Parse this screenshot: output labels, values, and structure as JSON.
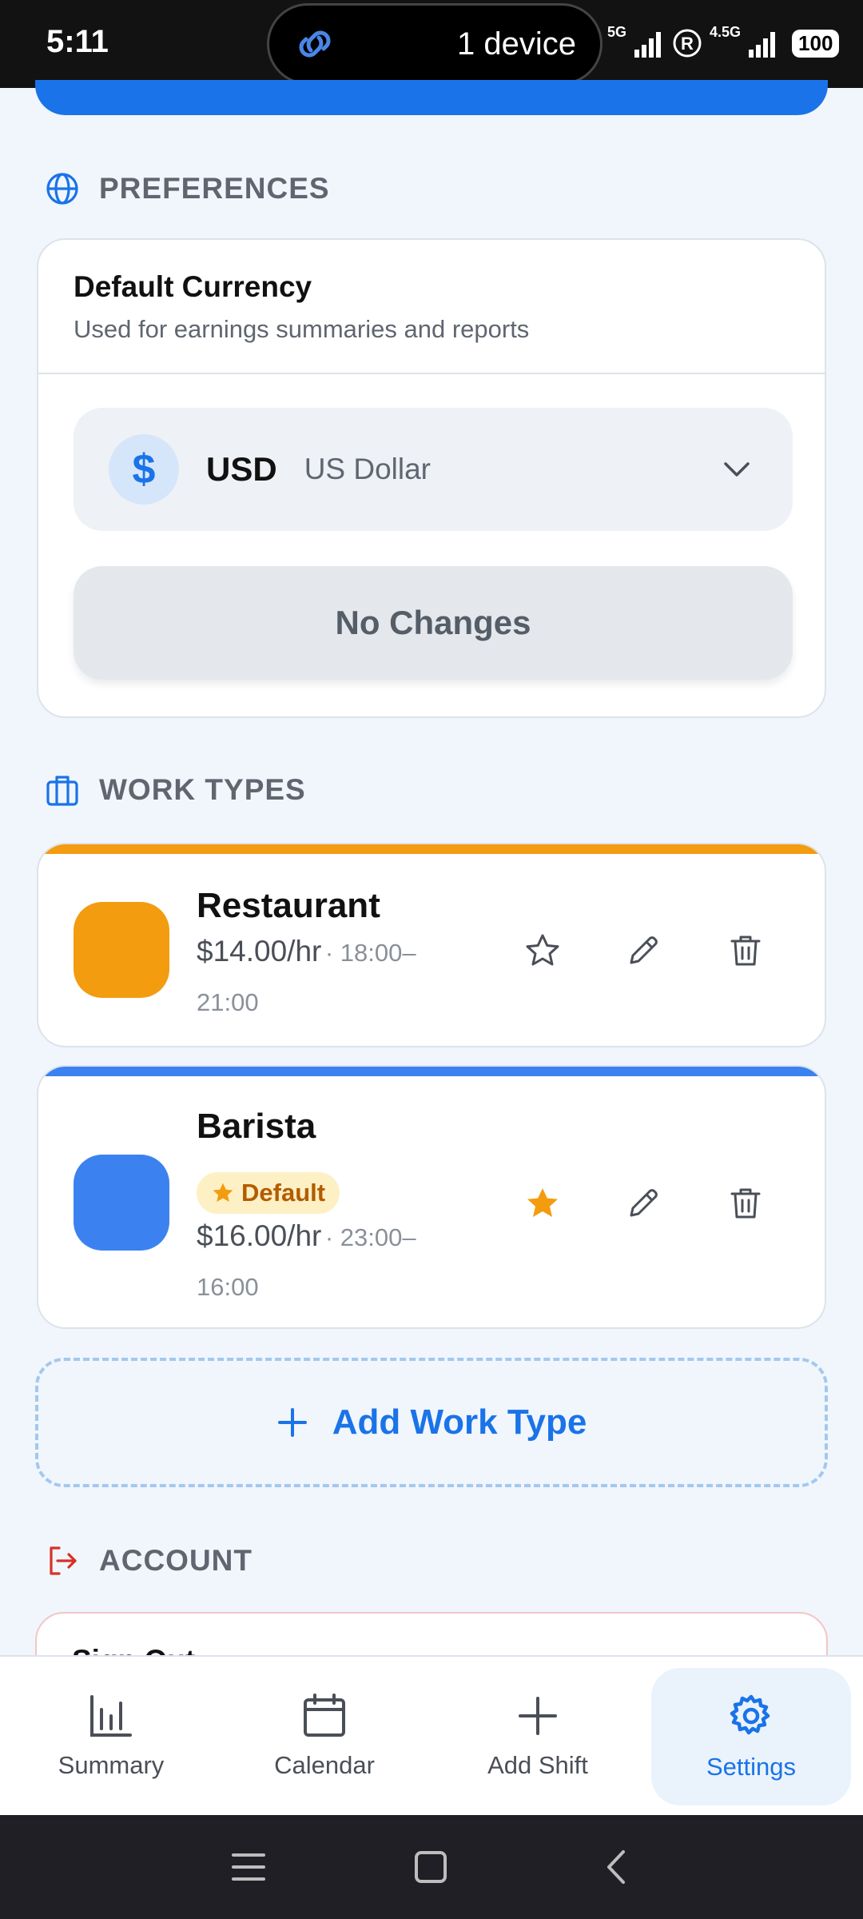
{
  "status_bar": {
    "time": "5:11",
    "pill_text": "1 device",
    "net1": "5G",
    "net2": "4.5G",
    "roaming": "R",
    "battery": "100"
  },
  "preferences": {
    "title": "PREFERENCES",
    "currency_card": {
      "title": "Default Currency",
      "subtitle": "Used for earnings summaries and reports",
      "symbol": "$",
      "code": "USD",
      "name": "US Dollar",
      "button_label": "No Changes"
    }
  },
  "work_types": {
    "title": "WORK TYPES",
    "items": [
      {
        "name": "Restaurant",
        "rate": "$14.00/hr",
        "time_a": "· 18:00–",
        "time_b": "21:00",
        "color": "#f39c0f",
        "is_default": false
      },
      {
        "name": "Barista",
        "badge": "Default",
        "rate": "$16.00/hr",
        "time_a": "· 23:00–",
        "time_b": "16:00",
        "color": "#3b82f0",
        "is_default": true
      }
    ],
    "add_label": "Add Work Type"
  },
  "account": {
    "title": "ACCOUNT",
    "signout_label": "Sign Out"
  },
  "bottom_nav": {
    "items": [
      {
        "label": "Summary",
        "icon": "bar-chart-icon"
      },
      {
        "label": "Calendar",
        "icon": "calendar-icon"
      },
      {
        "label": "Add Shift",
        "icon": "plus-icon"
      },
      {
        "label": "Settings",
        "icon": "gear-icon",
        "active": true
      }
    ]
  },
  "colors": {
    "accent": "#1a73e8",
    "restaurant": "#f39c0f",
    "barista": "#3b82f0",
    "star_active": "#f39c0f",
    "danger": "#d93025"
  }
}
